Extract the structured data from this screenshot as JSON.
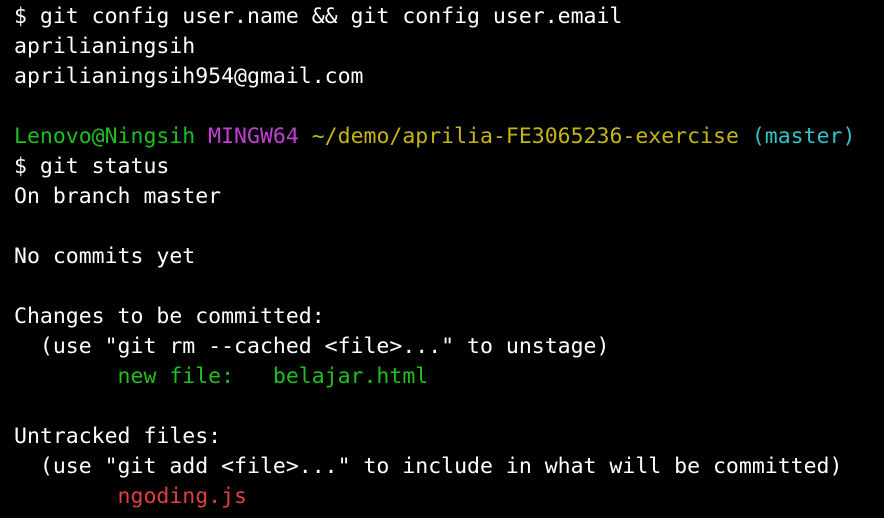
{
  "terminal": {
    "lines": [
      [
        {
          "text": "$ git config user.name && git config user.email",
          "color": "default"
        }
      ],
      [
        {
          "text": "aprilianingsih",
          "color": "default"
        }
      ],
      [
        {
          "text": "aprilianingsih954@gmail.com",
          "color": "default"
        }
      ],
      [],
      [
        {
          "text": "Lenovo@Ningsih",
          "color": "green"
        },
        {
          "text": " ",
          "color": "default"
        },
        {
          "text": "MINGW64",
          "color": "magenta"
        },
        {
          "text": " ",
          "color": "default"
        },
        {
          "text": "~/demo/aprilia-FE3065236-exercise",
          "color": "yellow"
        },
        {
          "text": " ",
          "color": "default"
        },
        {
          "text": "(master)",
          "color": "cyan"
        }
      ],
      [
        {
          "text": "$ git status",
          "color": "default"
        }
      ],
      [
        {
          "text": "On branch master",
          "color": "default"
        }
      ],
      [],
      [
        {
          "text": "No commits yet",
          "color": "default"
        }
      ],
      [],
      [
        {
          "text": "Changes to be committed:",
          "color": "default"
        }
      ],
      [
        {
          "text": "  (use \"git rm --cached <file>...\" to unstage)",
          "color": "default"
        }
      ],
      [
        {
          "text": "        new file:   belajar.html",
          "color": "green"
        }
      ],
      [],
      [
        {
          "text": "Untracked files:",
          "color": "default"
        }
      ],
      [
        {
          "text": "  (use \"git add <file>...\" to include in what will be committed)",
          "color": "default"
        }
      ],
      [
        {
          "text": "        ngoding.js",
          "color": "red"
        }
      ]
    ]
  },
  "colors": {
    "background": "#000000",
    "default": "#ffffff",
    "green": "#1fbf1f",
    "magenta": "#c33ed6",
    "yellow": "#c4b514",
    "cyan": "#2fc4c9",
    "red": "#e0403e"
  }
}
